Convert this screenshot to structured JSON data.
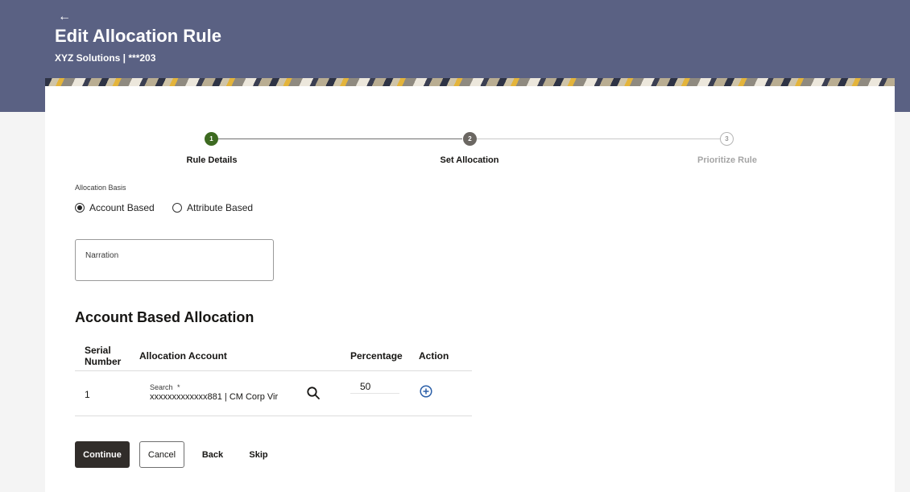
{
  "header": {
    "back_icon": "left-arrow-icon",
    "title": "Edit Allocation Rule",
    "subtitle": "XYZ Solutions | ***203"
  },
  "stepper": {
    "steps": [
      {
        "number": "1",
        "label": "Rule Details",
        "status": "completed"
      },
      {
        "number": "2",
        "label": "Set Allocation",
        "status": "current"
      },
      {
        "number": "3",
        "label": "Prioritize Rule",
        "status": "pending"
      }
    ]
  },
  "allocation_basis": {
    "label": "Allocation Basis",
    "options": [
      "Account Based",
      "Attribute Based"
    ],
    "selected": "Account Based"
  },
  "narration": {
    "label": "Narration",
    "value": ""
  },
  "section": {
    "title": "Account Based Allocation"
  },
  "table": {
    "headers": {
      "serial_line1": "Serial",
      "serial_line2": "Number",
      "account": "Allocation Account",
      "percentage": "Percentage",
      "action": "Action"
    },
    "rows": [
      {
        "serial": "1",
        "search_label": "Search",
        "required_mark": "*",
        "account": "xxxxxxxxxxxxx881 | CM Corp Vir",
        "percentage": "50",
        "search_icon": "search-icon",
        "action_icon": "add-circle-icon"
      }
    ]
  },
  "actions": {
    "continue": "Continue",
    "cancel": "Cancel",
    "back": "Back",
    "skip": "Skip"
  },
  "colors": {
    "header_bg": "#5a6183",
    "step_done": "#3d6a21",
    "step_current": "#6b6762",
    "primary_button": "#312d2a",
    "add_icon": "#2b5fa8"
  }
}
